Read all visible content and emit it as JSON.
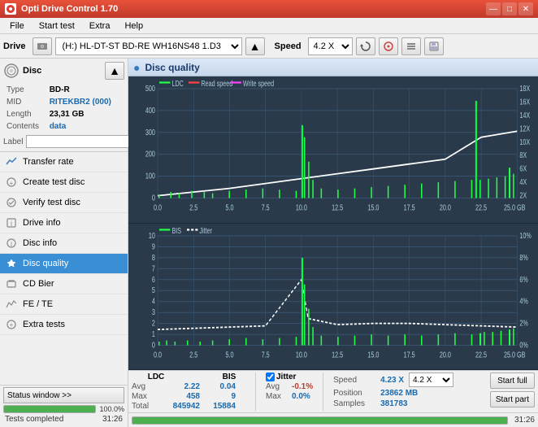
{
  "titleBar": {
    "title": "Opti Drive Control 1.70",
    "minimize": "—",
    "maximize": "□",
    "close": "✕"
  },
  "menuBar": {
    "items": [
      "File",
      "Start test",
      "Extra",
      "Help"
    ]
  },
  "toolbar": {
    "driveLabel": "Drive",
    "driveValue": "(H:)  HL-DT-ST BD-RE  WH16NS48 1.D3",
    "speedLabel": "Speed",
    "speedValue": "4.2 X"
  },
  "discPanel": {
    "title": "Disc",
    "fields": [
      {
        "label": "Type",
        "value": "BD-R"
      },
      {
        "label": "MID",
        "value": "RITEKBR2 (000)"
      },
      {
        "label": "Length",
        "value": "23,31 GB"
      },
      {
        "label": "Contents",
        "value": "data"
      },
      {
        "label": "Label",
        "value": ""
      }
    ]
  },
  "navItems": [
    {
      "id": "transfer-rate",
      "label": "Transfer rate",
      "icon": "📈"
    },
    {
      "id": "create-test-disc",
      "label": "Create test disc",
      "icon": "💿"
    },
    {
      "id": "verify-test-disc",
      "label": "Verify test disc",
      "icon": "✔"
    },
    {
      "id": "drive-info",
      "label": "Drive info",
      "icon": "ℹ"
    },
    {
      "id": "disc-info",
      "label": "Disc info",
      "icon": "ℹ"
    },
    {
      "id": "disc-quality",
      "label": "Disc quality",
      "icon": "★",
      "active": true
    },
    {
      "id": "cd-bier",
      "label": "CD Bier",
      "icon": "🎵"
    },
    {
      "id": "fe-te",
      "label": "FE / TE",
      "icon": "📊"
    },
    {
      "id": "extra-tests",
      "label": "Extra tests",
      "icon": "🔧"
    }
  ],
  "statusWindow": {
    "label": "Status window >>",
    "progress": 100,
    "progressText": "100.0%",
    "statusText": "Tests completed",
    "time": "31:26"
  },
  "chartPanel": {
    "title": "Disc quality",
    "legend1": {
      "ldc": "LDC",
      "readSpeed": "Read speed",
      "writeSpeed": "Write speed"
    },
    "legend2": {
      "bis": "BIS",
      "jitter": "Jitter"
    },
    "yAxisTop": [
      "500",
      "400",
      "300",
      "200",
      "100",
      "0"
    ],
    "yAxisTopRight": [
      "18X",
      "16X",
      "14X",
      "12X",
      "10X",
      "8X",
      "6X",
      "4X",
      "2X"
    ],
    "xAxis": [
      "0.0",
      "2.5",
      "5.0",
      "7.5",
      "10.0",
      "12.5",
      "15.0",
      "17.5",
      "20.0",
      "22.5",
      "25.0 GB"
    ],
    "yAxisBottom": [
      "10",
      "9",
      "8",
      "7",
      "6",
      "5",
      "4",
      "3",
      "2",
      "1",
      "0"
    ],
    "yAxisBottomRight": [
      "10%",
      "8%",
      "6%",
      "4%",
      "2%",
      "0%"
    ]
  },
  "statsBar": {
    "columns": [
      "LDC",
      "BIS"
    ],
    "rows": [
      {
        "label": "Avg",
        "ldc": "2.22",
        "bis": "0.04"
      },
      {
        "label": "Max",
        "ldc": "458",
        "bis": "9"
      },
      {
        "label": "Total",
        "ldc": "845942",
        "bis": "15884"
      }
    ],
    "jitterChecked": true,
    "jitterLabel": "Jitter",
    "jitterValues": {
      "avg": "-0.1%",
      "max": "0.0%",
      "total": ""
    },
    "rightPanel": {
      "speedLabel": "Speed",
      "speedValue": "4.23 X",
      "speedDropdown": "4.2 X",
      "positionLabel": "Position",
      "positionValue": "23862 MB",
      "samplesLabel": "Samples",
      "samplesValue": "381783"
    },
    "buttons": {
      "startFull": "Start full",
      "startPart": "Start part"
    }
  }
}
